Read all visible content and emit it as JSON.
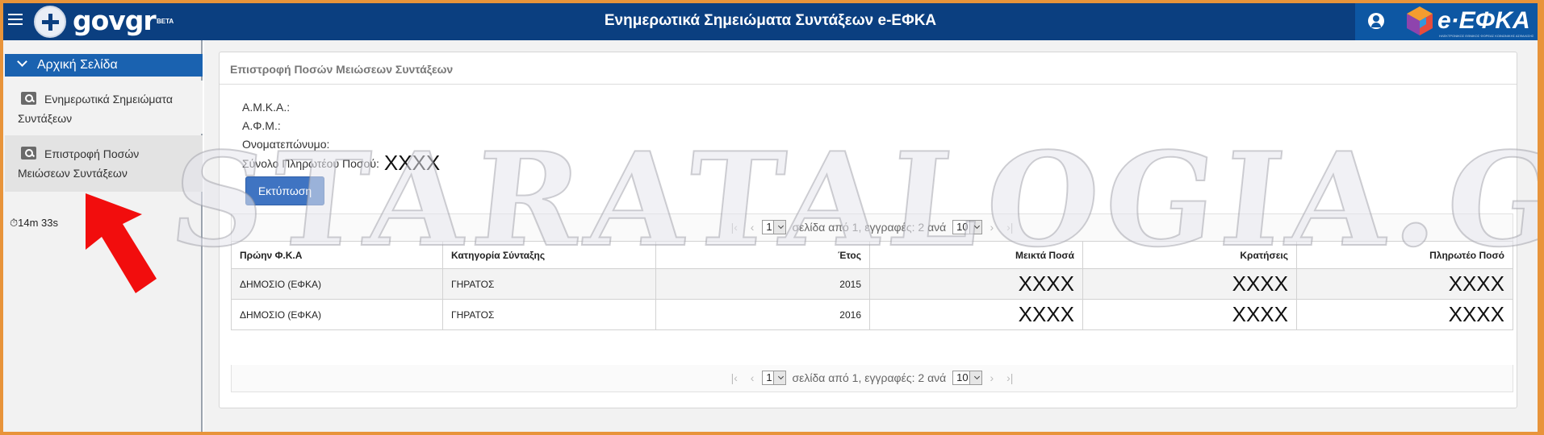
{
  "header": {
    "gov_logo": "govgr",
    "gov_beta": "BETA",
    "title": "Ενημερωτικά Σημειώματα Συντάξεων e-ΕΦΚΑ",
    "efka_logo": "e·ΕΦΚΑ",
    "efka_subtitle": "ΗΛΕΚΤΡΟΝΙΚΟΣ ΕΘΝΙΚΟΣ ΦΟΡΕΑΣ ΚΟΙΝΩΝΙΚΗΣ ΑΣΦΑΛΙΣΗΣ"
  },
  "sidebar": {
    "home": "Αρχική Σελίδα",
    "items": [
      {
        "label": "Ενημερωτικά Σημειώματα Συντάξεων"
      },
      {
        "label": "Επιστροφή Ποσών Μειώσεων Συντάξεων"
      }
    ],
    "timer": "⏱14m 33s"
  },
  "panel": {
    "title": "Επιστροφή Ποσών Μειώσεων Συντάξεων",
    "amka_label": "Α.Μ.Κ.Α.:",
    "afm_label": "Α.Φ.Μ.:",
    "name_label": "Ονοματεπώνυμο:",
    "total_label": "Σύνολο Πληρωτέου Ποσού:",
    "total_value": "XXXX",
    "print_button": "Εκτύπωση"
  },
  "pager": {
    "page": "1",
    "text": "σελίδα από 1, εγγραφές: 2 ανά",
    "per_page": "10"
  },
  "table": {
    "headers": [
      "Πρώην Φ.Κ.Α",
      "Κατηγορία Σύνταξης",
      "Έτος",
      "Μεικτά Ποσά",
      "Κρατήσεις",
      "Πληρωτέο Ποσό"
    ],
    "rows": [
      [
        "ΔΗΜΟΣΙΟ (ΕΦΚΑ)",
        "ΓΗΡΑΤΟΣ",
        "2015",
        "XXXX",
        "XXXX",
        "XXXX"
      ],
      [
        "ΔΗΜΟΣΙΟ (ΕΦΚΑ)",
        "ΓΗΡΑΤΟΣ",
        "2016",
        "XXXX",
        "XXXX",
        "XXXX"
      ]
    ]
  },
  "watermark": "STARATALOGIA.GR"
}
